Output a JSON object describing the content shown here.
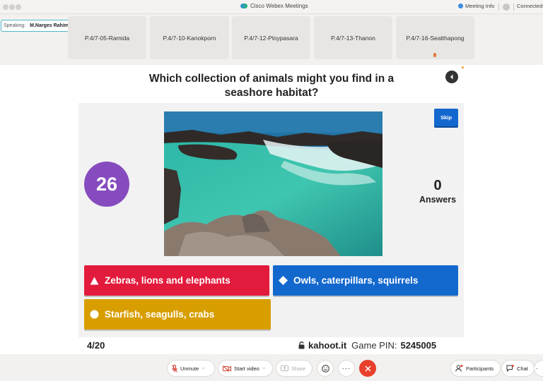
{
  "window": {
    "title": "Cisco Webex Meetings",
    "meeting_info": "Meeting Info",
    "status": "Connected"
  },
  "speaking": {
    "label": "Speaking:",
    "name": "M.Narges Rahimiparvar (C..."
  },
  "participants": [
    "P.4/7-05-Ramida",
    "P.4/7-10-Kanokporn",
    "P.4/7-12-Ploypasara",
    "P.4/7-13-Thanon",
    "P.4/7-16-Seatthapong"
  ],
  "quiz": {
    "question": "Which collection of animals might you find in a seashore habitat?",
    "skip_label": "Skip",
    "timer": "26",
    "answers_count": "0",
    "answers_label": "Answers",
    "options": [
      {
        "shape": "triangle",
        "text": "Zebras, lions and elephants",
        "color": "#e21b3c"
      },
      {
        "shape": "diamond",
        "text": "Owls, caterpillars, squirrels",
        "color": "#1368ce"
      },
      {
        "shape": "circle",
        "text": "Starfish, seagulls, crabs",
        "color": "#d89e00"
      }
    ],
    "progress": "4/20",
    "site": "kahoot.it",
    "pin_label": "Game PIN:",
    "pin": "5245005"
  },
  "controls": {
    "unmute": "Unmute",
    "start_video": "Start video",
    "share": "Share",
    "participants": "Participants",
    "chat": "Chat"
  },
  "colors": {
    "timer": "#864cbf",
    "skip": "#1368ce",
    "end_call": "#e8402c",
    "speaking_border": "#4fb8c8"
  }
}
